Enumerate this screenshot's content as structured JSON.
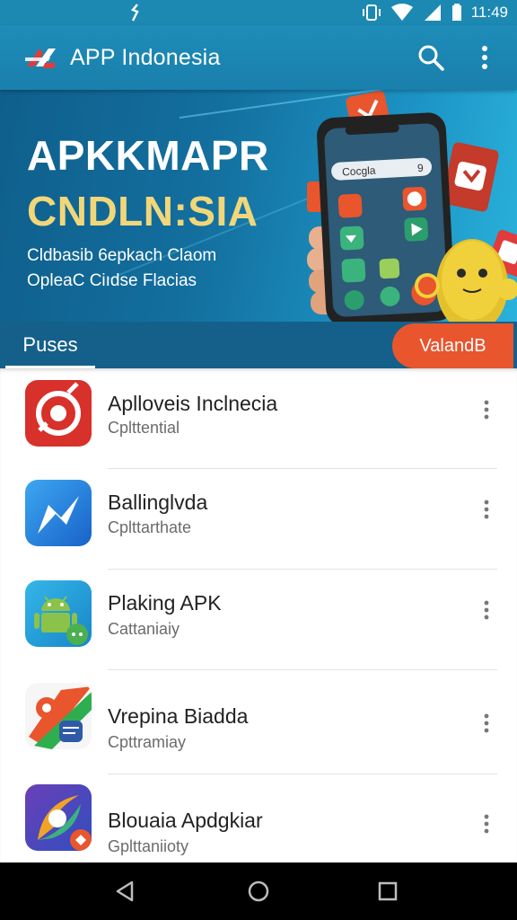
{
  "status_bar": {
    "time": "11:49",
    "icons": [
      "notification-icon",
      "vibrate-icon",
      "wifi-icon",
      "signal-icon",
      "battery-icon"
    ]
  },
  "app_bar": {
    "title": "APP Indonesia",
    "logo": "app-logo-icon",
    "actions": [
      "search-icon",
      "more-vert-icon"
    ]
  },
  "banner": {
    "title": "APKKMAPR",
    "subtitle": "CNDLN:SIA",
    "line1": "Cldbasib 6epkach Claom",
    "line2": "OpleaC Ciıdse Flacias",
    "phone_search": "Cocgla",
    "phone_search_badge": "9"
  },
  "tabs": {
    "active_label": "Puses",
    "action_label": "ValandB"
  },
  "apps": [
    {
      "name": "Aplloveis Inclnecia",
      "subtitle": "Cplttential",
      "icon": "target-app-icon"
    },
    {
      "name": "Ballinglvda",
      "subtitle": "Cplttarthate",
      "icon": "messenger-app-icon"
    },
    {
      "name": "Plaking APK",
      "subtitle": "Cattaniaiy",
      "icon": "android-app-icon"
    },
    {
      "name": "Vrepina Biadda",
      "subtitle": "Cpttramiay",
      "icon": "map-chat-app-icon"
    },
    {
      "name": "Blouaia Apdgkiar",
      "subtitle": "Gplttaniioty",
      "icon": "swirl-app-icon"
    }
  ],
  "nav_bar": {
    "buttons": [
      "back-icon",
      "home-icon",
      "recents-icon"
    ]
  },
  "colors": {
    "app_bar": "#1e8cb8",
    "tab_strip": "#15608a",
    "accent_orange": "#e9552d",
    "banner_gold": "#f1d77a"
  }
}
